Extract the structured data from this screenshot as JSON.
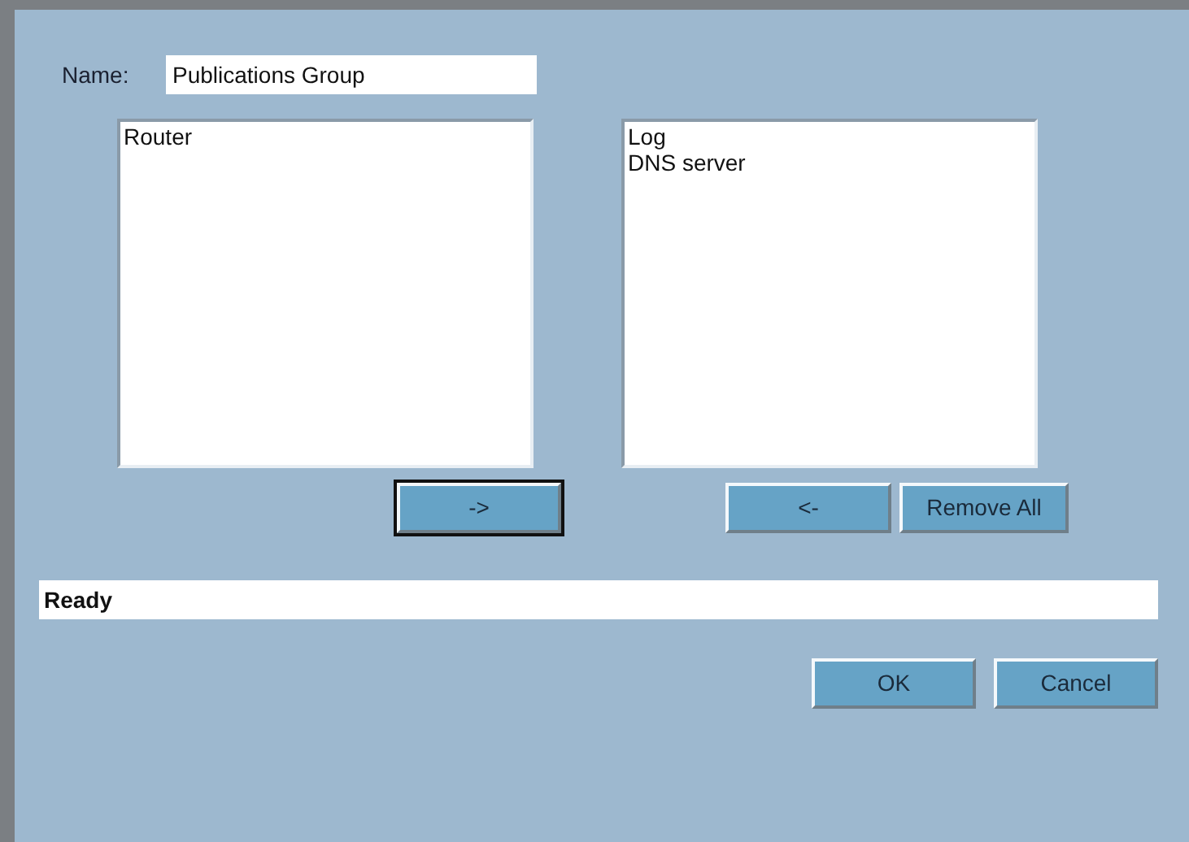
{
  "name_field": {
    "label": "Name:",
    "value": "Publications Group"
  },
  "available_list": {
    "items": [
      {
        "label": "Router",
        "selected": false
      }
    ]
  },
  "selected_list": {
    "items": [
      {
        "label": "Log",
        "selected": false
      },
      {
        "label": "DNS server",
        "selected": false
      }
    ]
  },
  "transfer_buttons": [
    {
      "label": "->",
      "focused": true
    },
    {
      "label": "<-",
      "focused": false
    },
    {
      "label": "Remove All",
      "focused": false
    }
  ],
  "status_bar": "Ready",
  "dialog_buttons": [
    {
      "label": "OK",
      "focused": false
    },
    {
      "label": "Cancel",
      "focused": false
    }
  ]
}
